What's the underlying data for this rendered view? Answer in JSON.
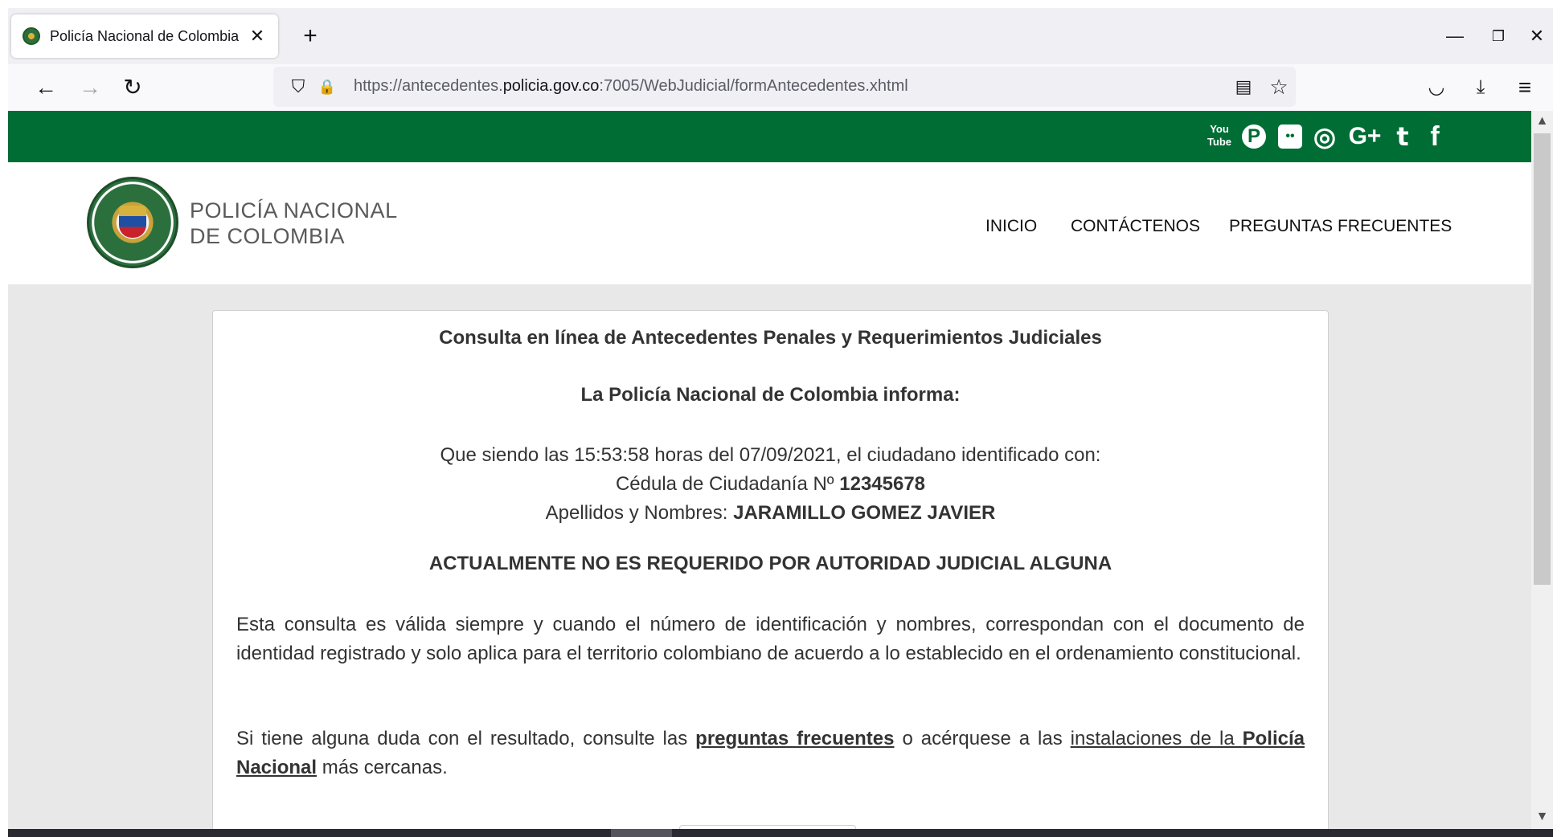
{
  "browser": {
    "tab_title": "Policía Nacional de Colombia",
    "tab_close": "✕",
    "new_tab": "+",
    "window_controls": {
      "minimize": "—",
      "restore": "❐",
      "close": "✕"
    },
    "nav": {
      "back": "←",
      "forward": "→",
      "reload": "↻"
    },
    "url_prefix": "https://antecedentes.",
    "url_domain": "policia.gov.co",
    "url_suffix": ":7005/WebJudicial/formAntecedentes.xhtml",
    "icons": {
      "shield": "⛉",
      "lock": "🔒",
      "reader": "▤",
      "bookmark": "☆",
      "pocket": "◡",
      "download": "⤓",
      "menu": "≡"
    }
  },
  "social": {
    "youtube": "You Tube",
    "pinterest": "P",
    "flickr": "••",
    "instagram": "◎",
    "googleplus": "G+",
    "twitter": "t",
    "facebook": "f"
  },
  "header": {
    "logo_line1": "POLICÍA NACIONAL",
    "logo_line2": "DE COLOMBIA",
    "menu": [
      "INICIO",
      "CONTÁCTENOS",
      "PREGUNTAS FRECUENTES"
    ]
  },
  "result": {
    "title": "Consulta en línea de Antecedentes Penales y Requerimientos Judiciales",
    "inform": "La Policía Nacional de Colombia informa:",
    "line1": "Que siendo las 15:53:58 horas del 07/09/2021, el ciudadano identificado con:",
    "id_label": "Cédula de Ciudadanía Nº ",
    "id_number": "12345678",
    "name_label": "Apellidos y Nombres: ",
    "name_value": "JARAMILLO GOMEZ JAVIER",
    "status": "ACTUALMENTE NO ES REQUERIDO POR AUTORIDAD JUDICIAL ALGUNA",
    "para1": "Esta consulta es válida siempre y cuando el número de identificación y nombres, correspondan con el documento de identidad registrado y solo aplica para el territorio colombiano de acuerdo a lo establecido en el ordenamiento constitucional.",
    "para2_a": "Si tiene alguna duda con el resultado, consulte las ",
    "para2_link1": "preguntas frecuentes",
    "para2_b": " o acérquese a las ",
    "para2_link2_a": "instalaciones de la ",
    "para2_link2_b": "Policía Nacional",
    "para2_c": " más cercanas."
  },
  "colors": {
    "brand_green": "#006d35",
    "page_bg": "#e8e8e8",
    "text": "#333333"
  }
}
